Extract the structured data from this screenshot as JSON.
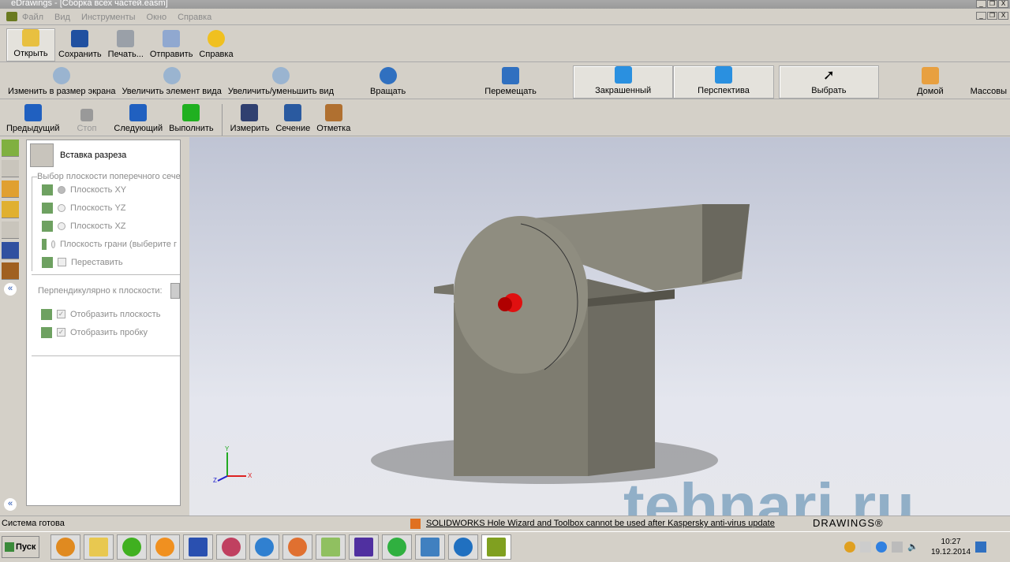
{
  "window": {
    "title": "eDrawings - [Сборка всех частей.easm]",
    "min": "_",
    "restore": "❐",
    "close": "X"
  },
  "menu": [
    "Файл",
    "Вид",
    "Инструменты",
    "Окно",
    "Справка"
  ],
  "toolbar1": [
    {
      "label": "Открыть",
      "color": "#e8c040"
    },
    {
      "label": "Сохранить",
      "color": "#2050a0"
    },
    {
      "label": "Печать...",
      "color": "#9aa0a8"
    },
    {
      "label": "Отправить",
      "color": "#90a8d0"
    },
    {
      "label": "Справка",
      "color": "#f0c020"
    }
  ],
  "toolbar2": [
    {
      "label": "Изменить в размер экрана"
    },
    {
      "label": "Увеличить элемент вида"
    },
    {
      "label": "Увеличить/уменьшить вид"
    },
    {
      "label": "Вращать"
    },
    {
      "label": "Перемещать"
    },
    {
      "label": "Закрашенный"
    },
    {
      "label": "Перспектива"
    },
    {
      "label": "Выбрать"
    },
    {
      "label": "Домой"
    },
    {
      "label": "Массовы"
    }
  ],
  "toolbar3": [
    {
      "label": "Предыдущий"
    },
    {
      "label": "Стоп"
    },
    {
      "label": "Следующий"
    },
    {
      "label": "Выполнить"
    },
    {
      "label": "Измерить"
    },
    {
      "label": "Сечение"
    },
    {
      "label": "Отметка"
    }
  ],
  "panel": {
    "title": "Вставка разреза",
    "group": "Выбор плоскости поперечного сечени",
    "options": [
      "Плоскость XY",
      "Плоскость YZ",
      "Плоскость XZ",
      "Плоскость грани (выберите г"
    ],
    "swap": "Переставить",
    "perp": "Перпендикулярно к плоскости:",
    "show_plane": "Отобразить плоскость",
    "show_cap": "Отобразить пробку"
  },
  "axes": {
    "x": "X",
    "y": "Y",
    "z": "Z"
  },
  "status": {
    "text": "Система готова",
    "news": "SOLIDWORKS Hole Wizard and Toolbox cannot be used after Kaspersky anti-virus update",
    "brand": "DRAWINGS®"
  },
  "taskbar": {
    "start": "Пуск",
    "time": "10:27",
    "date": "19.12.2014"
  },
  "watermark": "tehnari.ru"
}
